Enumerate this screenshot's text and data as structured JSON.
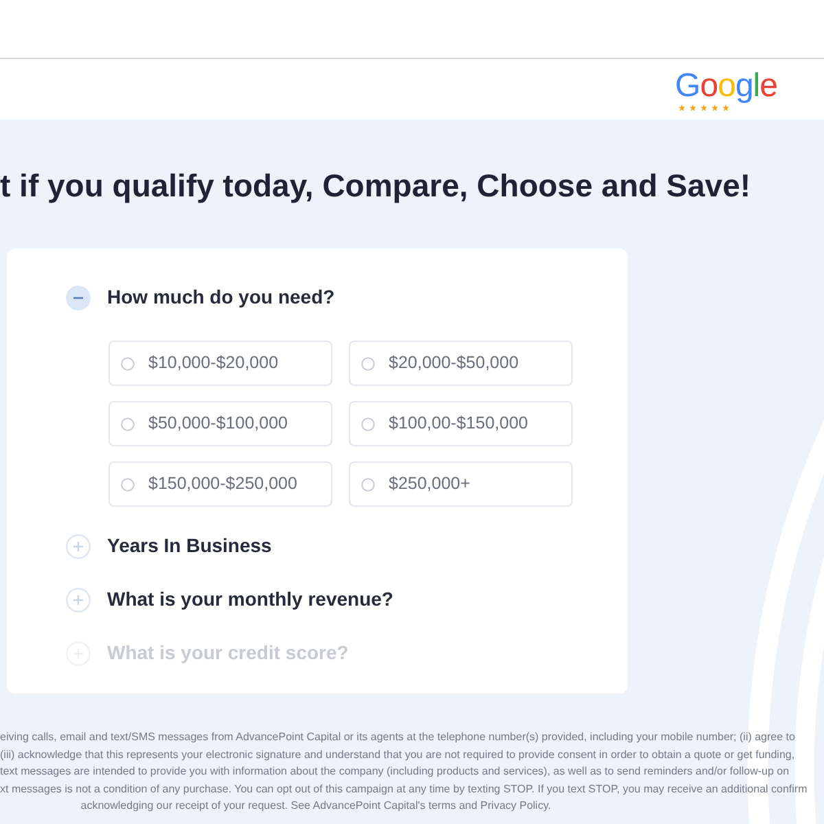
{
  "header": {
    "logo": {
      "text": "Google",
      "stars": 5
    }
  },
  "headline": "t if you qualify today, Compare, Choose and Save!",
  "form": {
    "questions": [
      {
        "label": "How much do you need?",
        "expanded": true,
        "disabled": false,
        "options": [
          {
            "label": "$10,000-$20,000",
            "selected": false
          },
          {
            "label": "$20,000-$50,000",
            "selected": false
          },
          {
            "label": "$50,000-$100,000",
            "selected": false
          },
          {
            "label": "$100,00-$150,000",
            "selected": false
          },
          {
            "label": "$150,000-$250,000",
            "selected": false
          },
          {
            "label": "$250,000+",
            "selected": false
          }
        ]
      },
      {
        "label": "Years In Business",
        "expanded": false,
        "disabled": false
      },
      {
        "label": "What is your monthly revenue?",
        "expanded": false,
        "disabled": false
      },
      {
        "label": "What is your credit score?",
        "expanded": false,
        "disabled": true
      }
    ]
  },
  "disclaimer": {
    "lines": [
      "eiving calls, email and text/SMS messages from AdvancePoint Capital or its agents at the telephone number(s) provided, including your mobile number; (ii) agree to",
      "(iii) acknowledge that this represents your electronic signature and understand that you are not required to provide consent in order to obtain a quote or get funding,",
      "text messages are intended to provide you with information about the company (including products and services), as well as to send reminders and/or follow-up on",
      "xt messages is not a condition of any purchase. You can opt out of this campaign at any time by texting STOP. If you text STOP, you may receive an additional confirm",
      "acknowledging our receipt of your request. See AdvancePoint Capital's terms and Privacy Policy."
    ]
  }
}
